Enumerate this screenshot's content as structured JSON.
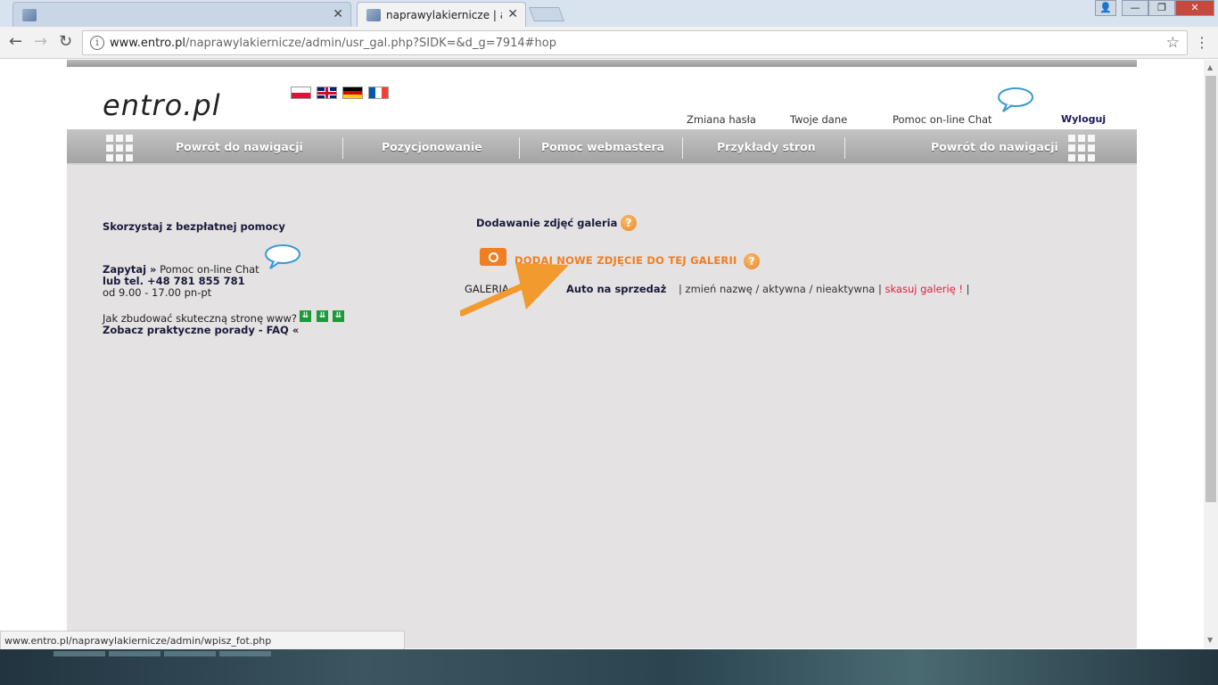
{
  "browser": {
    "tabs": [
      {
        "title": "",
        "active": false
      },
      {
        "title": "naprawylakiernicze | adm",
        "active": true
      }
    ],
    "address": {
      "host": "www.entro.pl",
      "path": "/naprawylakiernicze/admin/usr_gal.php?SIDK=&d_g=7914#hop"
    },
    "status_url": "www.entro.pl/naprawylakiernicze/admin/wpisz_fot.php"
  },
  "site": {
    "logo": "entro.pl",
    "header_links": {
      "change_password": "Zmiana hasła",
      "your_data": "Twoje dane",
      "help_chat": "Pomoc on-line Chat",
      "logout": "Wyloguj"
    },
    "menu": [
      "Powrót do nawigacji",
      "Pozycjonowanie",
      "Pomoc webmastera",
      "Przykłady stron",
      "Powrót do nawigacji"
    ],
    "sidebar": {
      "title": "Skorzystaj z bezpłatnej pomocy",
      "ask": "Zapytaj »",
      "ask_rest": " Pomoc on-line Chat",
      "tel": "lub tel. +48 781 855 781",
      "hours": "od 9.00 - 17.00 pn-pt",
      "howto": "Jak zbudować skuteczną stronę www?",
      "faq": "Zobacz praktyczne porady - FAQ «"
    },
    "main": {
      "title": "Dodawanie zdjęć galeria",
      "add_photo": "DODAJ NOWE ZDJĘCIE DO TEJ GALERII",
      "gallery_prefix": "GALERIA o naz",
      "gallery_name": "Auto na sprzedaż",
      "actions_text": "| zmień nazwę / aktywna / nieaktywna | ",
      "delete": "skasuj galerię !",
      "trail": " |"
    }
  },
  "colors": {
    "accent": "#f07e22",
    "menubar": "#a3a3a3",
    "content_bg": "#e4e2e3",
    "delete": "#e0203c"
  }
}
